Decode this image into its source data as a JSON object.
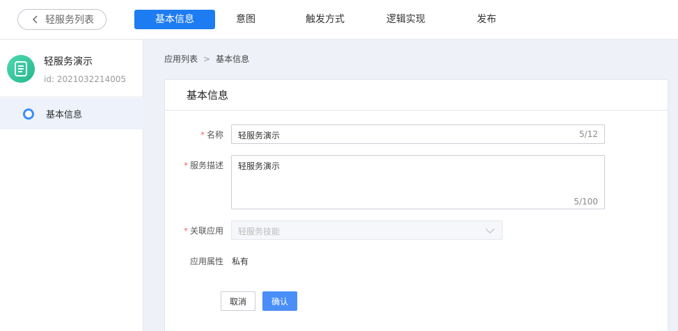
{
  "header": {
    "back_label": "轻服务列表",
    "tabs": [
      {
        "label": "基本信息",
        "active": true
      },
      {
        "label": "意图",
        "active": false
      },
      {
        "label": "触发方式",
        "active": false
      },
      {
        "label": "逻辑实现",
        "active": false
      },
      {
        "label": "发布",
        "active": false
      }
    ]
  },
  "sidebar": {
    "service_name": "轻服务演示",
    "service_id": "id: 2021032214005",
    "items": [
      {
        "label": "基本信息",
        "selected": true
      }
    ]
  },
  "breadcrumb": {
    "root": "应用列表",
    "separator": ">",
    "current": "基本信息"
  },
  "panel": {
    "title": "基本信息",
    "form": {
      "name_label": "名称",
      "name_value": "轻服务演示",
      "name_count": "5/12",
      "desc_label": "服务描述",
      "desc_value": "轻服务演示",
      "desc_count": "5/100",
      "app_label": "关联应用",
      "app_placeholder": "轻服务技能",
      "attr_label": "应用属性",
      "attr_value": "私有",
      "required_mark": "*"
    },
    "actions": {
      "cancel_label": "取消",
      "confirm_label": "确认"
    }
  },
  "colors": {
    "accent": "#1d7cf2",
    "required": "#f56c6c",
    "logo": "#25b78d"
  }
}
